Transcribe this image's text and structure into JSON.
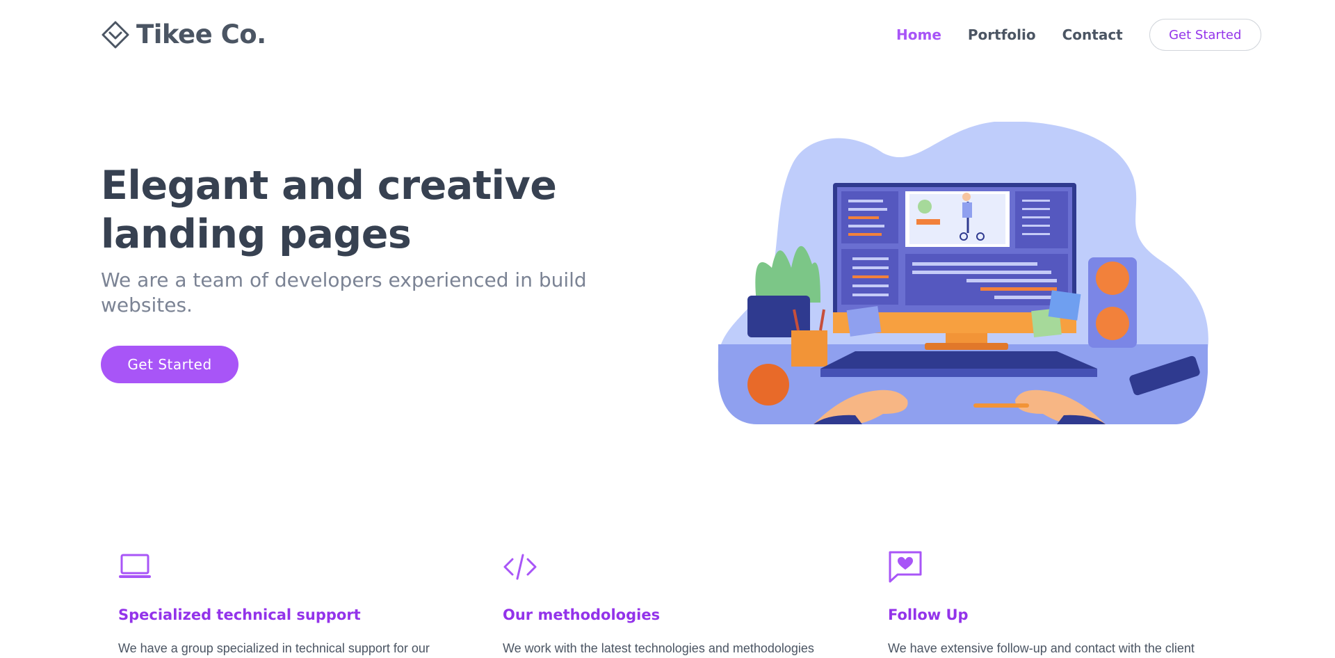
{
  "brand": {
    "name": "Tikee Co.",
    "accent_color": "#a855f7",
    "text_color": "#4b5563"
  },
  "nav": {
    "items": [
      {
        "label": "Home",
        "active": true
      },
      {
        "label": "Portfolio",
        "active": false
      },
      {
        "label": "Contact",
        "active": false
      }
    ],
    "cta_label": "Get Started"
  },
  "hero": {
    "title": "Elegant and creative landing pages",
    "subtitle": "We are a team of developers experienced in build websites.",
    "button_label": "Get Started",
    "illustration_icon": "developer-desk-illustration"
  },
  "features": [
    {
      "icon": "laptop-icon",
      "title": "Specialized technical support",
      "text": "We have a group specialized in technical support for our"
    },
    {
      "icon": "code-icon",
      "title": "Our methodologies",
      "text": "We work with the latest technologies and methodologies"
    },
    {
      "icon": "chat-heart-icon",
      "title": "Follow Up",
      "text": "We have extensive follow-up and contact with the client"
    }
  ]
}
